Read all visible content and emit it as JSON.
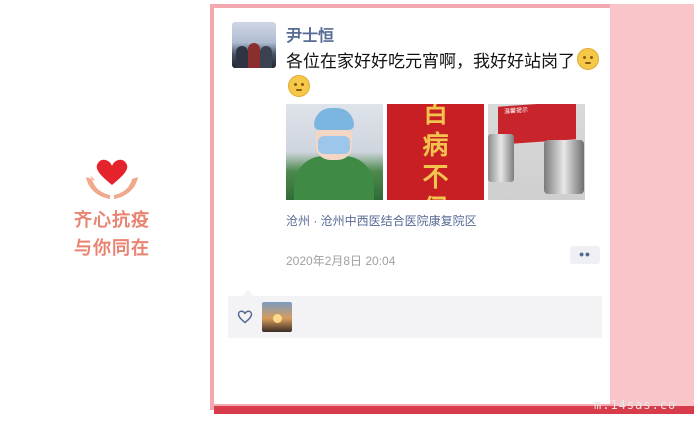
{
  "badge": {
    "line1": "齐心抗疫",
    "line2": "与你同在",
    "icon": "heart-hands-icon"
  },
  "post": {
    "username": "尹士恒",
    "text": "各位在家好好吃元宵啊，我好好站岗了",
    "location": "沧州 · 沧州中西医结合医院康复院区",
    "time": "2020年2月8日 20:04",
    "photos": [
      {
        "icon": "doctor-photo"
      },
      {
        "icon": "red-calligraphy-photo",
        "calligraphy": "百\n病\n不\n侵"
      },
      {
        "icon": "canisters-photo",
        "sign_text": "温馨提示"
      }
    ],
    "more": "••"
  },
  "likes": {
    "icon": "heart-outline-icon"
  },
  "watermark": "m.14sas.co"
}
